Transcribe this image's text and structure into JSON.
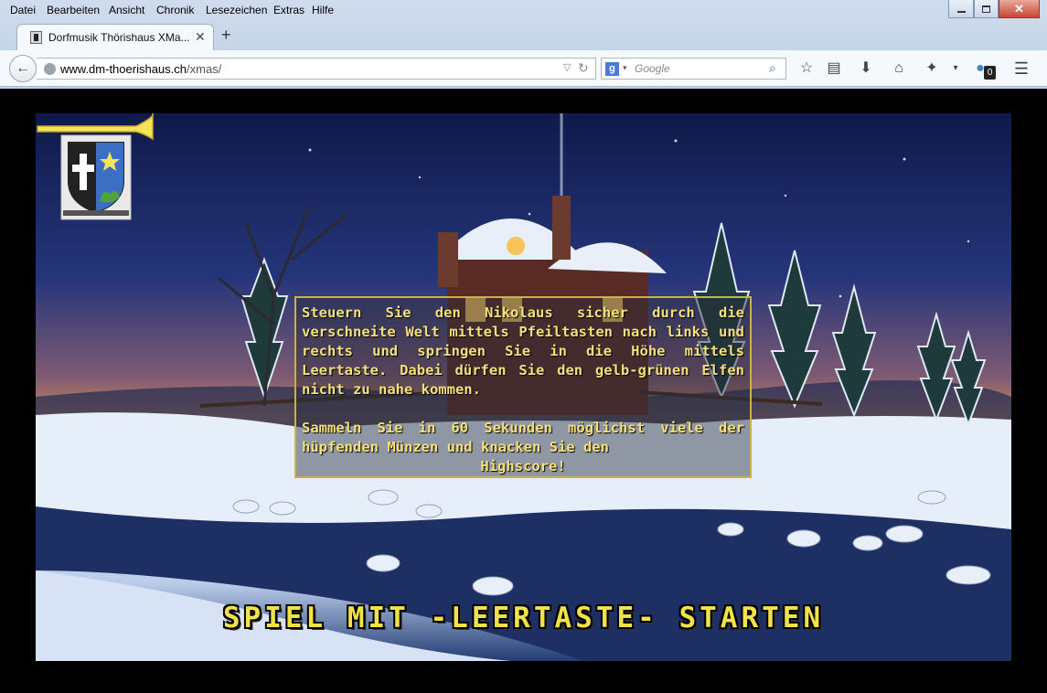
{
  "menu": {
    "items": [
      "Datei",
      "Bearbeiten",
      "Ansicht",
      "Chronik",
      "Lesezeichen",
      "Extras",
      "Hilfe"
    ]
  },
  "window_controls": {
    "minimize_icon": "minimize-icon",
    "maximize_icon": "maximize-icon",
    "close_icon": "close-icon"
  },
  "tab": {
    "title": "Dorfmusik Thörishaus XMa...",
    "close_glyph": "✕",
    "new_tab_glyph": "+"
  },
  "navbar": {
    "back_glyph": "←",
    "url_host": "www.dm-thoerishaus.ch",
    "url_path": "/xmas/",
    "search_engine_letter": "g",
    "search_placeholder": "Google",
    "notification_count": "0"
  },
  "game": {
    "instructions_1": "Steuern Sie den Nikolaus sicher durch die verschneite Welt mittels Pfeiltasten nach links und rechts und springen Sie in die Höhe mittels Leertaste. Dabei dürfen Sie den gelb-grünen Elfen nicht zu nahe kommen.",
    "instructions_2a": "Sammeln Sie in 60 Sekunden möglichst viele der hüpfenden Münzen und knacken Sie den",
    "instructions_2b": "Highscore!",
    "start_prompt": "SPIEL MIT -LEERTASTE- STARTEN"
  },
  "colors": {
    "accent_text": "#f4e07a",
    "start_text": "#f2e24a",
    "box_border": "#c9b24a"
  }
}
